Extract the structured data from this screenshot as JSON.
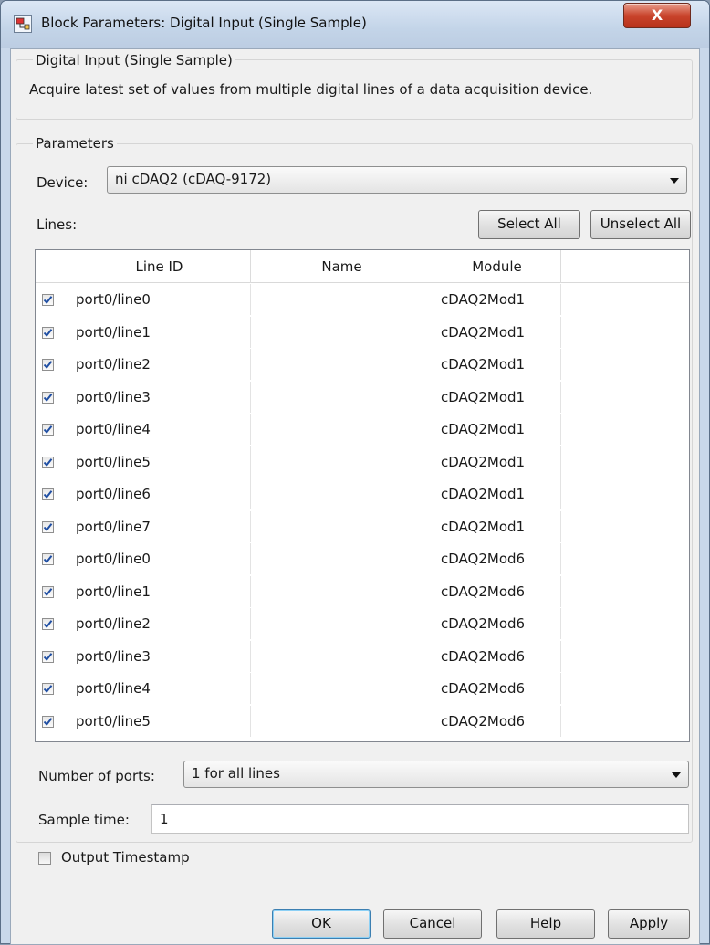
{
  "window": {
    "title": "Block Parameters: Digital Input (Single Sample)",
    "close_glyph": "X"
  },
  "description_group": {
    "label": "Digital Input (Single Sample)",
    "text": "Acquire latest set of values from multiple digital lines of a data acquisition device."
  },
  "parameters": {
    "label": "Parameters",
    "device_label": "Device:",
    "device_value": "ni cDAQ2 (cDAQ-9172)",
    "lines_label": "Lines:",
    "select_all": "Select All",
    "unselect_all": "Unselect All",
    "columns": [
      "Line ID",
      "Name",
      "Module"
    ],
    "rows": [
      {
        "checked": true,
        "line_id": "port0/line0",
        "name": "",
        "module": "cDAQ2Mod1"
      },
      {
        "checked": true,
        "line_id": "port0/line1",
        "name": "",
        "module": "cDAQ2Mod1"
      },
      {
        "checked": true,
        "line_id": "port0/line2",
        "name": "",
        "module": "cDAQ2Mod1"
      },
      {
        "checked": true,
        "line_id": "port0/line3",
        "name": "",
        "module": "cDAQ2Mod1"
      },
      {
        "checked": true,
        "line_id": "port0/line4",
        "name": "",
        "module": "cDAQ2Mod1"
      },
      {
        "checked": true,
        "line_id": "port0/line5",
        "name": "",
        "module": "cDAQ2Mod1"
      },
      {
        "checked": true,
        "line_id": "port0/line6",
        "name": "",
        "module": "cDAQ2Mod1"
      },
      {
        "checked": true,
        "line_id": "port0/line7",
        "name": "",
        "module": "cDAQ2Mod1"
      },
      {
        "checked": true,
        "line_id": "port0/line0",
        "name": "",
        "module": "cDAQ2Mod6"
      },
      {
        "checked": true,
        "line_id": "port0/line1",
        "name": "",
        "module": "cDAQ2Mod6"
      },
      {
        "checked": true,
        "line_id": "port0/line2",
        "name": "",
        "module": "cDAQ2Mod6"
      },
      {
        "checked": true,
        "line_id": "port0/line3",
        "name": "",
        "module": "cDAQ2Mod6"
      },
      {
        "checked": true,
        "line_id": "port0/line4",
        "name": "",
        "module": "cDAQ2Mod6"
      },
      {
        "checked": true,
        "line_id": "port0/line5",
        "name": "",
        "module": "cDAQ2Mod6"
      }
    ],
    "ports_label": "Number of ports:",
    "ports_value": "1 for all lines",
    "sample_time_label": "Sample time:",
    "sample_time_value": "1",
    "output_timestamp_label": "Output Timestamp",
    "output_timestamp_checked": false
  },
  "buttons": {
    "ok": {
      "mnemonic": "O",
      "rest": "K"
    },
    "cancel": {
      "mnemonic": "C",
      "rest": "ancel"
    },
    "help": {
      "mnemonic": "H",
      "rest": "elp"
    },
    "apply": {
      "mnemonic": "A",
      "rest": "pply"
    }
  },
  "colors": {
    "check": "#1f4ea3",
    "window_frame": "#c9d8ea"
  }
}
